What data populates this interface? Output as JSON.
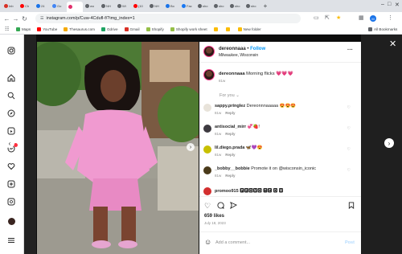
{
  "browser": {
    "tabs": [
      {
        "label": "Inb",
        "color": "#d93025"
      },
      {
        "label": "Ch",
        "color": "#ff0000"
      },
      {
        "label": "24",
        "color": "#1a73e8"
      },
      {
        "label": "Go",
        "color": "#4285f4"
      },
      {
        "label": "",
        "color": "#e1306c"
      },
      {
        "label": "wo",
        "color": "#5f6368"
      },
      {
        "label": "NH",
        "color": "#5f6368"
      },
      {
        "label": "Wi",
        "color": "#5f6368"
      },
      {
        "label": "(10",
        "color": "#ff0000"
      },
      {
        "label": "NH",
        "color": "#5f6368"
      },
      {
        "label": "Bo",
        "color": "#1a73e8"
      },
      {
        "label": "Fac",
        "color": "#1877f2"
      },
      {
        "label": "sho",
        "color": "#5f6368"
      },
      {
        "label": "sho",
        "color": "#5f6368"
      },
      {
        "label": "sho",
        "color": "#5f6368"
      },
      {
        "label": "sho",
        "color": "#5f6368"
      }
    ],
    "new_tab": "+",
    "url": "instagram.com/p/Cuw-4Cdufl-f/?img_index=1",
    "bookmarks": [
      {
        "label": "Maps",
        "color": "#34a853"
      },
      {
        "label": "YouTube",
        "color": "#ff0000"
      },
      {
        "label": "Thesaurus.com",
        "color": "#f4a900"
      },
      {
        "label": "Gdrive",
        "color": "#1fa463"
      },
      {
        "label": "Gmail",
        "color": "#d93025"
      },
      {
        "label": "Shopify",
        "color": "#95bf47"
      },
      {
        "label": "Shopify work sheet",
        "color": "#95bf47"
      },
      {
        "label": "",
        "color": "#fbbc04"
      },
      {
        "label": "",
        "color": "#fbbc04"
      },
      {
        "label": "New folder",
        "color": "#fbbc04"
      }
    ],
    "all_bookmarks": "All Bookmarks"
  },
  "post": {
    "username": "dereonnaaa",
    "follow_label": "Follow",
    "location": "Milwaukee, Wisconsin",
    "more_icon": "···",
    "caption_user": "dereonnaaa",
    "caption_text": "Morning flicks 💗💗💗",
    "caption_age": "81w",
    "for_you": "For you",
    "likes": "659 likes",
    "date": "July 18, 2023",
    "comment_placeholder": "Add a comment...",
    "post_button": "Post"
  },
  "comments": [
    {
      "user": "sappy.pringlez",
      "text": "Dereonnnaaaaa 😍😍😍",
      "age": "81w",
      "reply": "Reply",
      "avatar_color": "#e8e3da"
    },
    {
      "user": "antisocial_mirr",
      "text": "💞🍓!",
      "age": "81w",
      "reply": "Reply",
      "avatar_color": "#3d3a40"
    },
    {
      "user": "lil.diego.prada",
      "text": "🦋💜😍",
      "age": "81w",
      "reply": "Reply",
      "avatar_color": "#c8c000"
    },
    {
      "user": "_bobby__bobbie",
      "text": "Promote it on @wisconsin_iconic",
      "age": "81w",
      "reply": "Reply",
      "avatar_color": "#4a3a1a"
    },
    {
      "user": "promoo915",
      "text": "🅿🆁🅾🅼🅾 🆃🅴 🅳 🅼",
      "age": "",
      "reply": "",
      "avatar_color": "#d32f2f"
    }
  ],
  "colors": {
    "accent": "#0095f6",
    "pink": "#e1306c"
  }
}
